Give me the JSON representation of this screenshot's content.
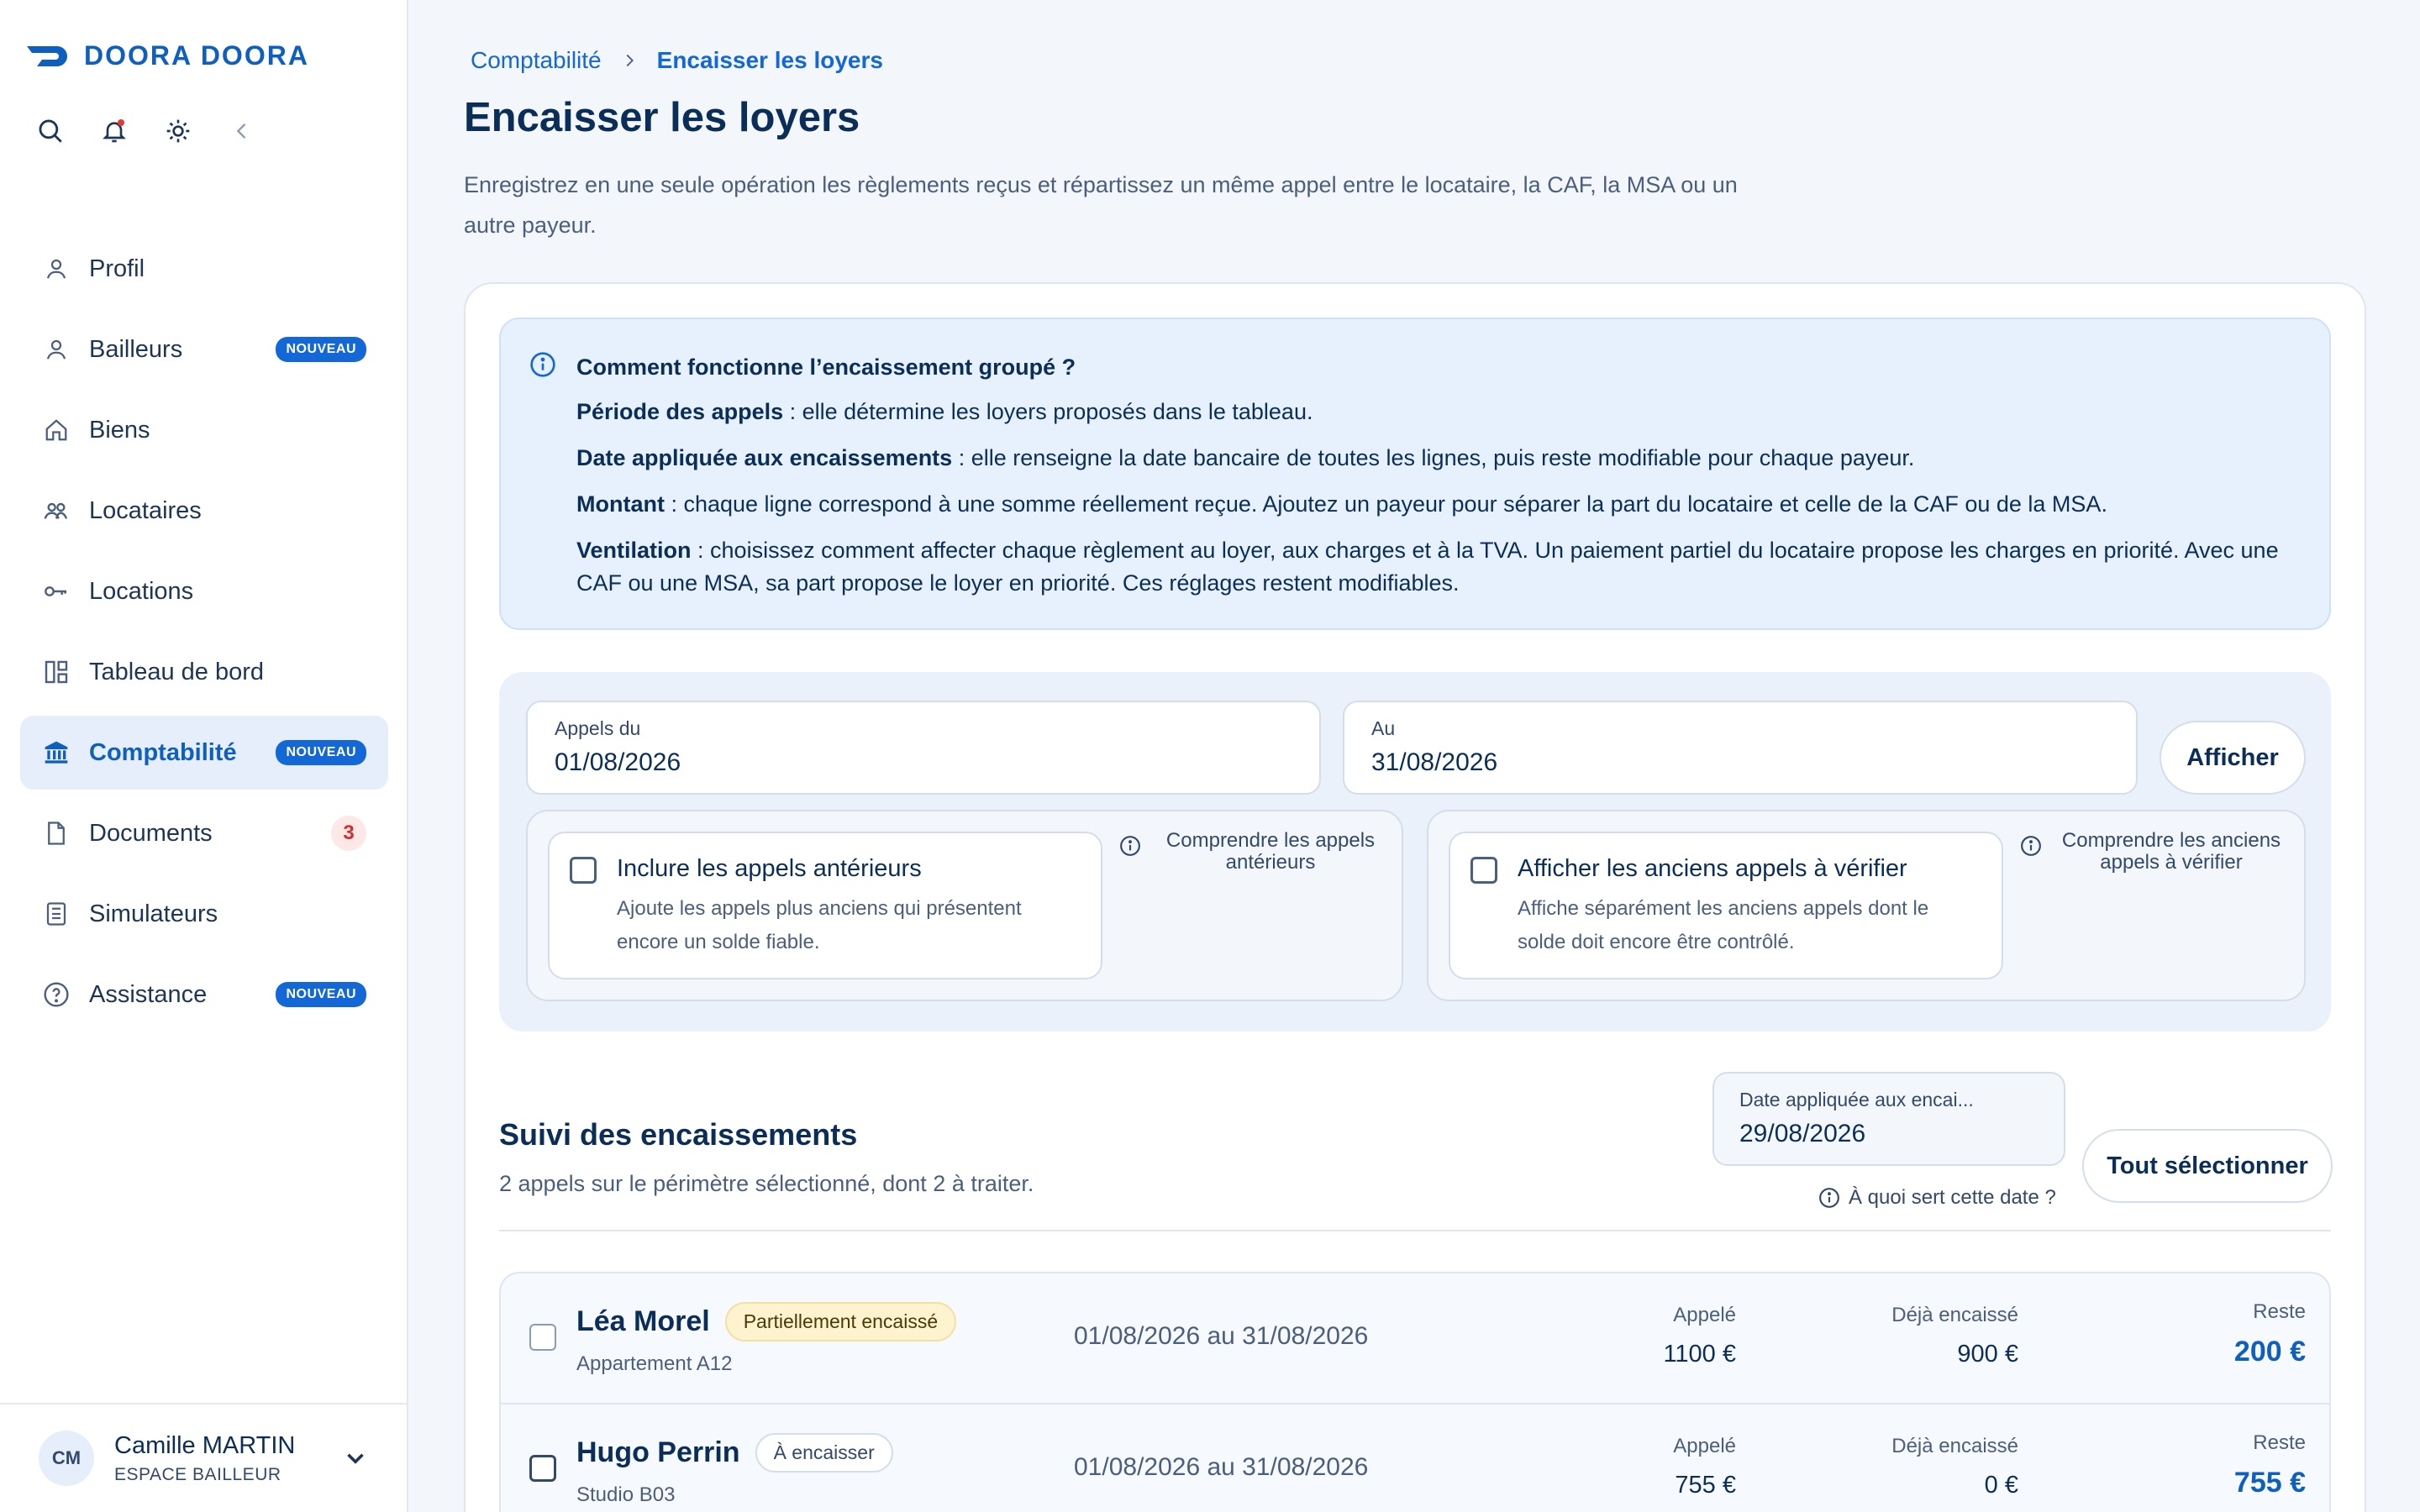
{
  "brand": {
    "name": "DOORA DOORA"
  },
  "sidebar": {
    "items": [
      {
        "label": "Profil",
        "icon": "user-icon"
      },
      {
        "label": "Bailleurs",
        "icon": "user-icon",
        "badge": "NOUVEAU"
      },
      {
        "label": "Biens",
        "icon": "home-icon"
      },
      {
        "label": "Locataires",
        "icon": "users-icon"
      },
      {
        "label": "Locations",
        "icon": "key-icon"
      },
      {
        "label": "Tableau de bord",
        "icon": "dashboard-icon"
      },
      {
        "label": "Comptabilité",
        "icon": "bank-icon",
        "badge": "NOUVEAU",
        "active": true
      },
      {
        "label": "Documents",
        "icon": "document-icon",
        "count": "3"
      },
      {
        "label": "Simulateurs",
        "icon": "calculator-icon"
      },
      {
        "label": "Assistance",
        "icon": "help-icon",
        "badge": "NOUVEAU"
      }
    ],
    "user": {
      "initials": "CM",
      "name": "Camille MARTIN",
      "role": "ESPACE BAILLEUR"
    }
  },
  "breadcrumb": {
    "parent": "Comptabilité",
    "current": "Encaisser les loyers"
  },
  "page": {
    "title": "Encaisser les loyers",
    "description": "Enregistrez en une seule opération les règlements reçus et répartissez un même appel entre le locataire, la CAF, la MSA ou un autre payeur."
  },
  "info": {
    "title": "Comment fonctionne l’encaissement groupé ?",
    "lines": [
      {
        "term": "Période des appels",
        "text": " : elle détermine les loyers proposés dans le tableau."
      },
      {
        "term": "Date appliquée aux encaissements",
        "text": " : elle renseigne la date bancaire de toutes les lignes, puis reste modifiable pour chaque payeur."
      },
      {
        "term": "Montant",
        "text": " : chaque ligne correspond à une somme réellement reçue. Ajoutez un payeur pour séparer la part du locataire et celle de la CAF ou de la MSA."
      },
      {
        "term": "Ventilation",
        "text": " : choisissez comment affecter chaque règlement au loyer, aux charges et à la TVA. Un paiement partiel du locataire propose les charges en priorité. Avec une CAF ou une MSA, sa part propose le loyer en priorité. Ces réglages restent modifiables."
      }
    ]
  },
  "filters": {
    "from": {
      "label": "Appels du",
      "value": "01/08/2026"
    },
    "to": {
      "label": "Au",
      "value": "31/08/2026"
    },
    "show_button": "Afficher",
    "option1": {
      "title": "Inclure les appels antérieurs",
      "desc": "Ajoute les appels plus anciens qui présentent encore un solde fiable.",
      "help": "Comprendre les appels antérieurs"
    },
    "option2": {
      "title": "Afficher les anciens appels à vérifier",
      "desc": "Affiche séparément les anciens appels dont le solde doit encore être contrôlé.",
      "help": "Comprendre les anciens appels à vérifier"
    }
  },
  "tracking": {
    "title": "Suivi des encaissements",
    "subtitle": "2 appels sur le périmètre sélectionné, dont 2 à traiter.",
    "apply_date": {
      "label": "Date appliquée aux encai...",
      "value": "29/08/2026",
      "help": "À quoi sert cette date ?"
    },
    "select_all": "Tout sélectionner",
    "col_called": "Appelé",
    "col_paid": "Déjà encaissé",
    "col_rest": "Reste",
    "rows": [
      {
        "name": "Léa Morel",
        "status": "Partiellement encaissé",
        "unit": "Appartement A12",
        "period": "01/08/2026 au 31/08/2026",
        "called": "1100 €",
        "paid": "900 €",
        "rest": "200 €"
      },
      {
        "name": "Hugo Perrin",
        "status": "À encaisser",
        "unit": "Studio B03",
        "period": "01/08/2026 au 31/08/2026",
        "called": "755 €",
        "paid": "0 €",
        "rest": "755 €"
      }
    ]
  },
  "colors": {
    "accent": "#1467d6",
    "navy": "#0b2e59",
    "info_bg": "#e6f1fd"
  }
}
